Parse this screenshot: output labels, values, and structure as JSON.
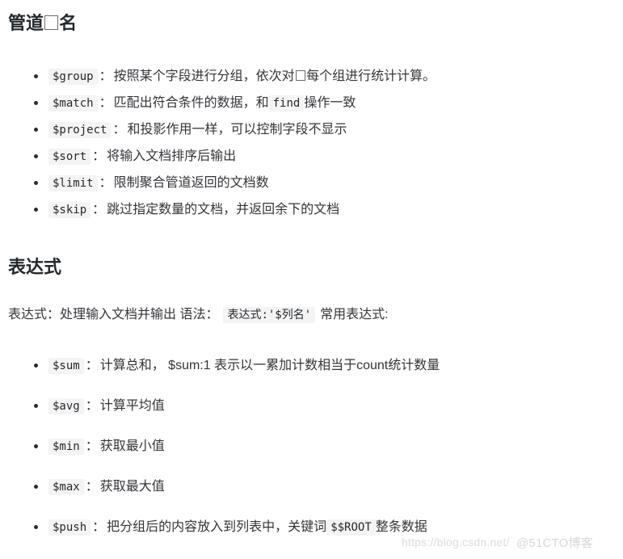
{
  "document": {
    "sections": [
      {
        "heading_prefix": "管道",
        "heading_suffix": "名",
        "heading_full": "管道□名",
        "items": [
          {
            "code": "$group",
            "separator": "：",
            "text_before": "按照某个字段进行分组，依次对",
            "text_after": "每个组进行统计计算。",
            "has_tofu": true,
            "text_full": "按照某个字段进行分组，依次对□每个组进行统计计算。"
          },
          {
            "code": "$match",
            "separator": "：",
            "text_before": "匹配出符合条件的数据，和",
            "inline_code": "find",
            "text_after": "操作一致",
            "has_tofu": false,
            "text_full": "匹配出符合条件的数据，和 find 操作一致"
          },
          {
            "code": "$project",
            "separator": "：",
            "text_before": "和投影作用一样，可以控制字段不显示",
            "text_after": "",
            "has_tofu": false,
            "text_full": "和投影作用一样，可以控制字段不显示"
          },
          {
            "code": "$sort",
            "separator": "：",
            "text_before": "将输入文档排序后输出",
            "text_after": "",
            "has_tofu": false,
            "text_full": "将输入文档排序后输出"
          },
          {
            "code": "$limit",
            "separator": "：",
            "text_before": "限制聚合管道返回的文档数",
            "text_after": "",
            "has_tofu": false,
            "text_full": "限制聚合管道返回的文档数"
          },
          {
            "code": "$skip",
            "separator": "：",
            "text_before": "跳过指定数量的文档，并返回余下的文档",
            "text_after": "",
            "has_tofu": false,
            "text_full": "跳过指定数量的文档，并返回余下的文档"
          }
        ]
      },
      {
        "heading": "表达式",
        "paragraph": {
          "text_before": "表达式：处理输入文档并输出 语法：",
          "code": "表达式:'$列名'",
          "text_after": "常用表达式:"
        },
        "items": [
          {
            "code": "$sum",
            "separator": "：",
            "text": "计算总和， $sum:1 表示以一累加计数相当于count统计数量"
          },
          {
            "code": "$avg",
            "separator": "：",
            "text": "计算平均值"
          },
          {
            "code": "$min",
            "separator": "：",
            "text": "获取最小值"
          },
          {
            "code": "$max",
            "separator": "：",
            "text": "获取最大值"
          },
          {
            "code": "$push",
            "separator": "：",
            "text_before": "把分组后的内容放入到列表中，关键词",
            "inline_code": "$$ROOT",
            "text_after": "整条数据"
          }
        ]
      }
    ]
  },
  "watermarks": {
    "url": "https://blog.csdn.net/",
    "site": "@51CTO博客"
  },
  "colors": {
    "text": "#34343a",
    "heading": "#24292e",
    "code_background": "#f4f4f4",
    "watermark": "#dcdce0",
    "page_background": "#ffffff"
  }
}
